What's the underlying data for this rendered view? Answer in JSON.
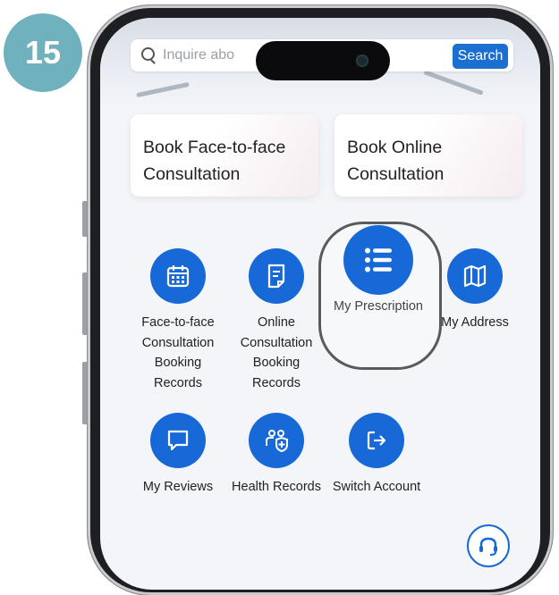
{
  "step_badge": "15",
  "search": {
    "placeholder": "Inquire abo",
    "button_label": "Search"
  },
  "cards": [
    {
      "title": "Book Face-to-face Consultation"
    },
    {
      "title": "Book Online Consultation"
    }
  ],
  "functions": [
    {
      "label": "Face-to-face Consultation Booking Records",
      "icon": "calendar-icon"
    },
    {
      "label": "Online Consultation Booking Records",
      "icon": "document-icon"
    },
    {
      "label": "My Prescription",
      "icon": "list-icon",
      "highlighted": true
    },
    {
      "label": "My Address",
      "icon": "map-icon"
    },
    {
      "label": "My Reviews",
      "icon": "chat-bubble-icon"
    },
    {
      "label": "Health Records",
      "icon": "family-shield-icon"
    },
    {
      "label": "Switch Account",
      "icon": "switch-arrow-icon"
    }
  ],
  "colors": {
    "primary": "#1669d6",
    "badge": "#6fb2bd",
    "search_button": "#1a6fd1"
  }
}
